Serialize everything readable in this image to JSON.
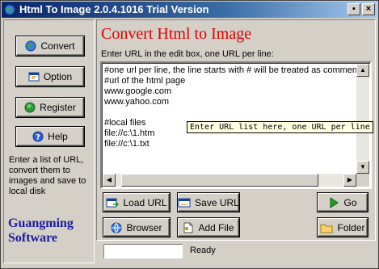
{
  "window": {
    "title": "Html To Image 2.0.4.1016 Trial Version"
  },
  "title_buttons": {
    "minimize": "▪",
    "close": "×"
  },
  "sidebar": {
    "buttons": [
      {
        "label": "Convert",
        "icon": "convert-globe-icon"
      },
      {
        "label": "Option",
        "icon": "option-window-icon"
      },
      {
        "label": "Register",
        "icon": "register-globe-icon"
      },
      {
        "label": "Help",
        "icon": "help-icon"
      }
    ],
    "description": "Enter a list of URL, convert them to images and save to local disk",
    "brand_line1": "Guangming",
    "brand_line2": "Software"
  },
  "main": {
    "heading": "Convert Html to Image",
    "instruction": "Enter URL in the edit box, one URL per line:",
    "editor_text": "#one url per line, the line starts with # will be treated as comment\n#url of the html page\nwww.google.com\nwww.yahoo.com\n\n#local files\nfile://c:\\1.htm\nfile://c:\\1.txt",
    "tooltip": "Enter URL list here, one URL per line"
  },
  "actions": {
    "load_url": "Load URL",
    "save_url": "Save URL",
    "go": "Go",
    "browser": "Browser",
    "add_file": "Add File",
    "folder": "Folder"
  },
  "status": {
    "text": "Ready",
    "field_value": ""
  },
  "colors": {
    "heading": "#e00000",
    "brand": "#1a1aa0",
    "titlebar_start": "#0a246a",
    "titlebar_end": "#a6caf0",
    "tooltip_bg": "#ffffe1"
  }
}
